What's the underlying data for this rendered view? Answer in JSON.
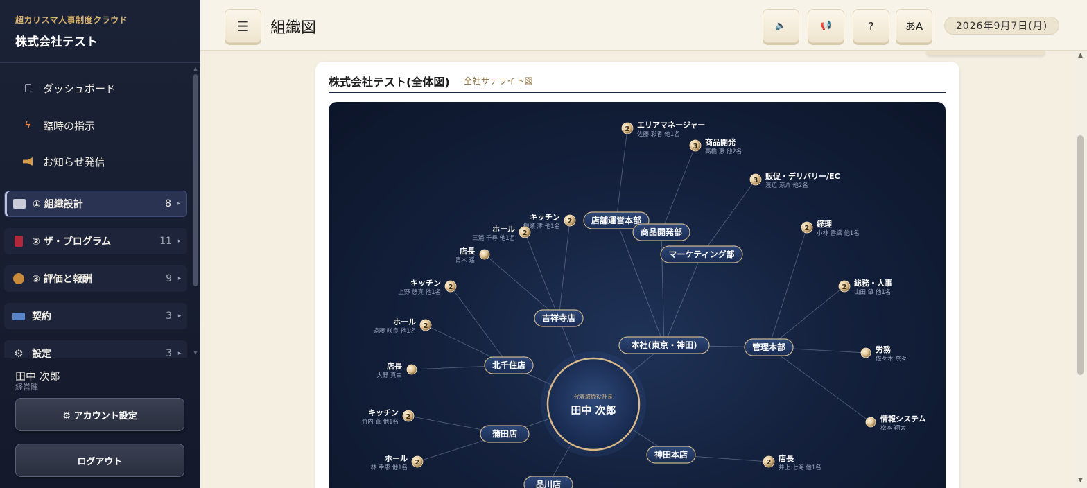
{
  "sidebar": {
    "brand_sub": "超カリスマ人事制度クラウド",
    "brand_title": "株式会社テスト",
    "nav": [
      {
        "label": "ダッシュボード",
        "icon": "building-icon"
      },
      {
        "label": "臨時の指示",
        "icon": "bolt-icon"
      },
      {
        "label": "お知らせ発信",
        "icon": "megaphone-icon"
      }
    ],
    "sections": [
      {
        "label": "① 組織設計",
        "count": "8",
        "active": true,
        "icon_color": "#c9cbd6"
      },
      {
        "label": "② ザ・プログラム",
        "count": "11",
        "active": false,
        "icon_color": "#b0283a"
      },
      {
        "label": "③ 評価と報酬",
        "count": "9",
        "active": false,
        "icon_color": "#c98a3a"
      },
      {
        "label": "契約",
        "count": "3",
        "active": false,
        "icon_color": "#5a86c8"
      },
      {
        "label": "設定",
        "count": "3",
        "active": false,
        "icon_color": "#d8d8d8"
      }
    ],
    "caret": "▸",
    "user_name": "田中 次郎",
    "user_role": "経営陣",
    "account_button": "⚙ アカウント設定",
    "logout_button": "ログアウト"
  },
  "header": {
    "menu_icon": "☰",
    "title": "組織図",
    "buttons": [
      {
        "name": "sound-button",
        "label": "🔈"
      },
      {
        "name": "notify-button",
        "label": "📢"
      },
      {
        "name": "help-button",
        "label": "?"
      },
      {
        "name": "font-size-button",
        "label": "あA"
      }
    ],
    "date": "2026年9月7日(月)"
  },
  "card": {
    "title": "株式会社テスト(全体図)",
    "subtitle": "全社サテライト図"
  },
  "org_chart": {
    "center": {
      "role": "代表取締役社長",
      "name": "田中 次郎"
    },
    "hubs": [
      {
        "id": "tenpo",
        "label": "店舗運営本部"
      },
      {
        "id": "shohin",
        "label": "商品開発部"
      },
      {
        "id": "marketing",
        "label": "マーケティング部"
      },
      {
        "id": "kichijoji",
        "label": "吉祥寺店"
      },
      {
        "id": "honsha",
        "label": "本社(東京・神田)"
      },
      {
        "id": "kanri",
        "label": "管理本部"
      },
      {
        "id": "kitasenju",
        "label": "北千住店"
      },
      {
        "id": "kamata",
        "label": "蒲田店"
      },
      {
        "id": "kanda",
        "label": "神田本店"
      },
      {
        "id": "shinagawa",
        "label": "品川店"
      }
    ],
    "leaves": [
      {
        "title": "エリアマネージャー",
        "members": "佐藤 彩香 他1名",
        "count": "2"
      },
      {
        "title": "商品開発",
        "members": "高橋 恵 他2名",
        "count": "3"
      },
      {
        "title": "販促・デリバリー/EC",
        "members": "渡辺 涼介 他2名",
        "count": "3"
      },
      {
        "title": "キッチン",
        "members": "柳瀬 澪 他1名",
        "count": "2"
      },
      {
        "title": "ホール",
        "members": "三浦 千尋 他1名",
        "count": "2"
      },
      {
        "title": "店長",
        "members": "青木 遥",
        "count": ""
      },
      {
        "title": "経理",
        "members": "小林 香織 他1名",
        "count": "2"
      },
      {
        "title": "キッチン",
        "members": "上野 悠真 他1名",
        "count": "2"
      },
      {
        "title": "総務・人事",
        "members": "山田 肇 他1名",
        "count": "2"
      },
      {
        "title": "ホール",
        "members": "遠藤 咲良 他1名",
        "count": "2"
      },
      {
        "title": "労務",
        "members": "佐々木 奈々",
        "count": ""
      },
      {
        "title": "店長",
        "members": "大野 真由",
        "count": ""
      },
      {
        "title": "キッチン",
        "members": "竹内 蒼 他1名",
        "count": "2"
      },
      {
        "title": "情報システム",
        "members": "松本 翔太",
        "count": ""
      },
      {
        "title": "ホール",
        "members": "林 幸恵 他1名",
        "count": "2"
      },
      {
        "title": "店長",
        "members": "井上 七海 他1名",
        "count": "2"
      }
    ]
  }
}
